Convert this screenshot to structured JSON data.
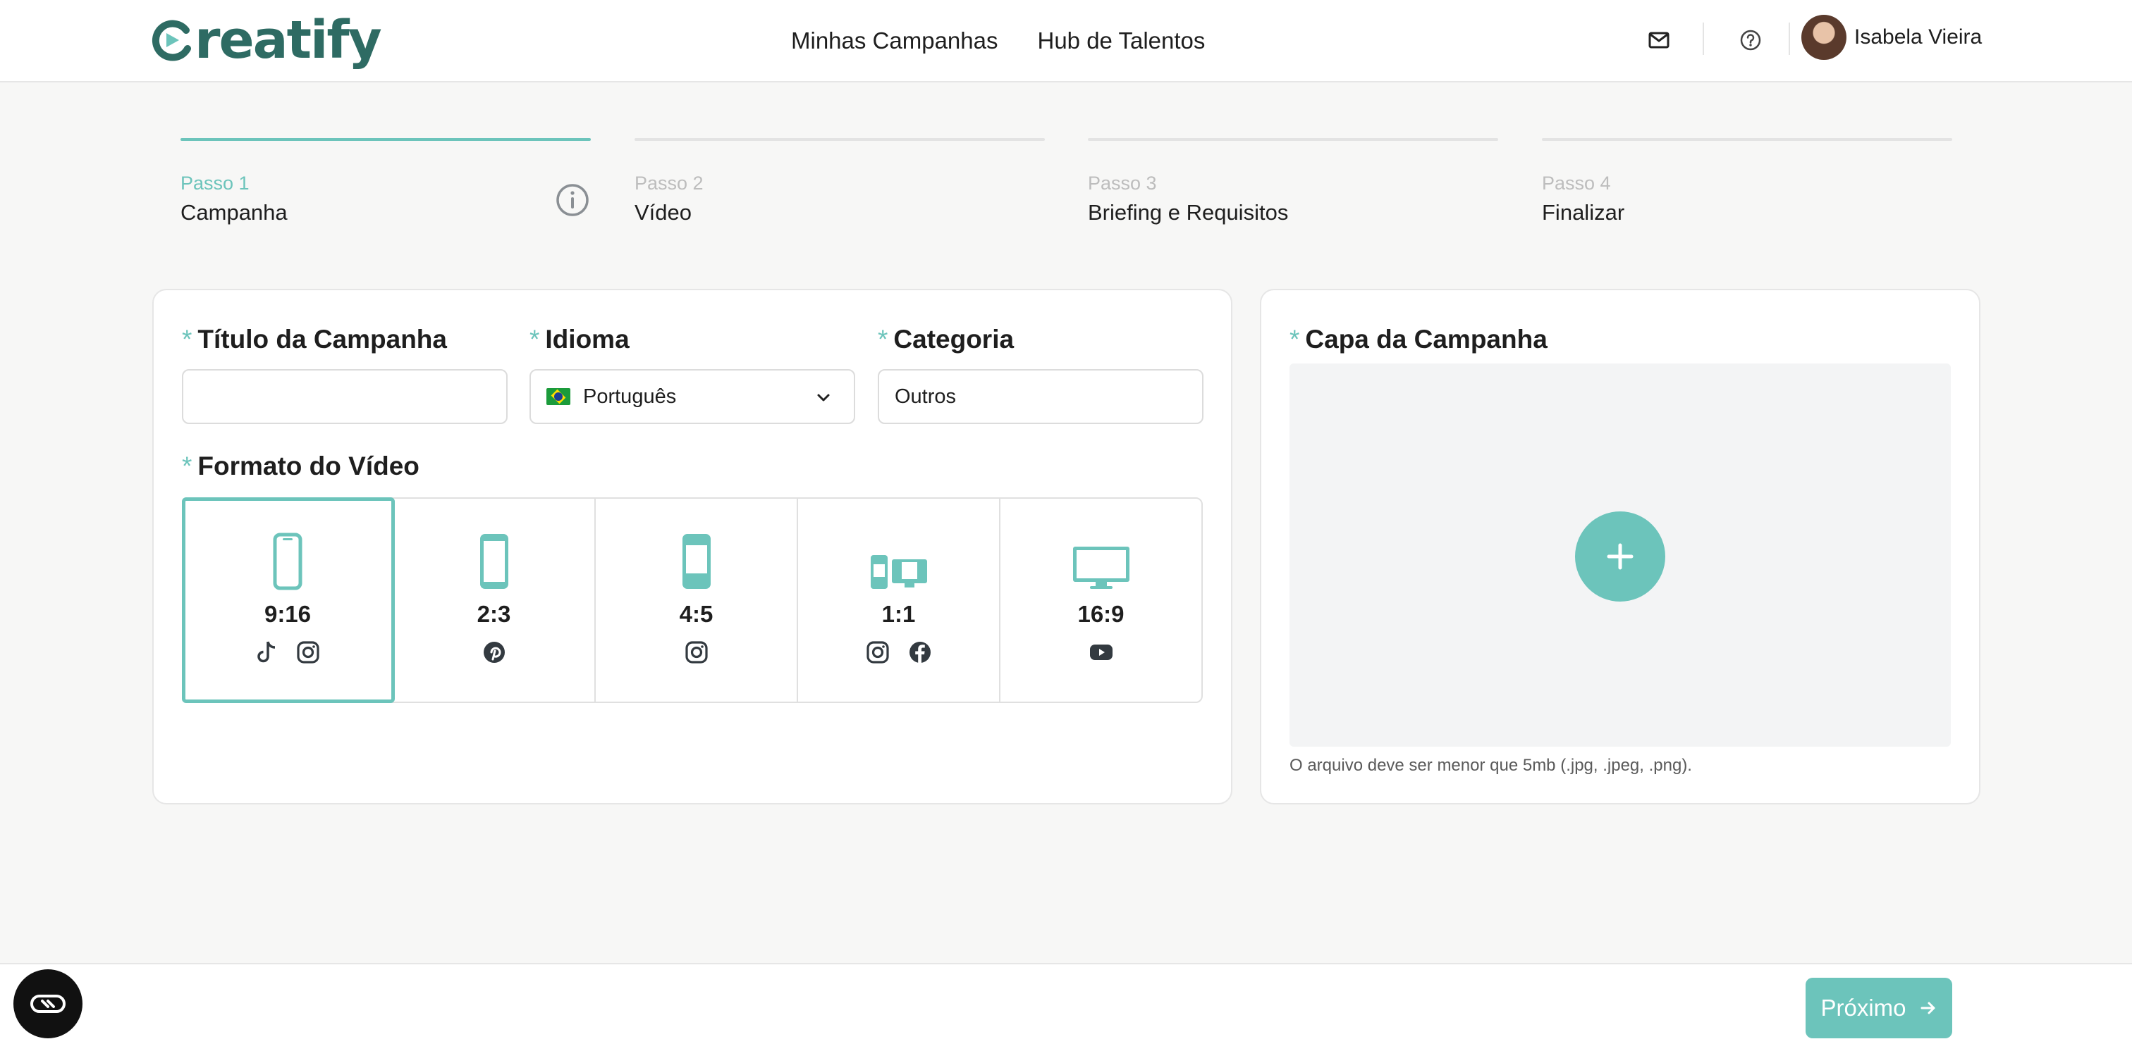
{
  "header": {
    "logo_text": "reatify",
    "nav": [
      "Minhas Campanhas",
      "Hub de Talentos"
    ],
    "user_name": "Isabela Vieira",
    "icons": [
      "mail-icon",
      "help-icon"
    ]
  },
  "steps": [
    {
      "num": "Passo 1",
      "name": "Campanha",
      "active": true
    },
    {
      "num": "Passo 2",
      "name": "Vídeo",
      "active": false
    },
    {
      "num": "Passo 3",
      "name": "Briefing e Requisitos",
      "active": false
    },
    {
      "num": "Passo 4",
      "name": "Finalizar",
      "active": false
    }
  ],
  "form": {
    "required_mark": "*",
    "title_label": "Título da Campanha",
    "title_value": "",
    "language_label": "Idioma",
    "language_value": "Português",
    "category_label": "Categoria",
    "category_value": "Outros",
    "format_label": "Formato do Vídeo",
    "formats": [
      {
        "ratio": "9:16",
        "socials": [
          "tiktok-icon",
          "instagram-icon"
        ],
        "selected": true
      },
      {
        "ratio": "2:3",
        "socials": [
          "pinterest-icon"
        ],
        "selected": false
      },
      {
        "ratio": "4:5",
        "socials": [
          "instagram-icon"
        ],
        "selected": false
      },
      {
        "ratio": "1:1",
        "socials": [
          "instagram-icon",
          "facebook-icon"
        ],
        "selected": false
      },
      {
        "ratio": "16:9",
        "socials": [
          "youtube-icon"
        ],
        "selected": false
      }
    ]
  },
  "cover": {
    "label": "Capa da Campanha",
    "hint": "O arquivo deve ser menor que 5mb (.jpg, .jpeg, .png)."
  },
  "footer": {
    "next_label": "Próximo"
  },
  "colors": {
    "accent": "#6cc4bb",
    "brand": "#2e6b63",
    "text": "#1e1e1e",
    "icon": "#333a40"
  }
}
